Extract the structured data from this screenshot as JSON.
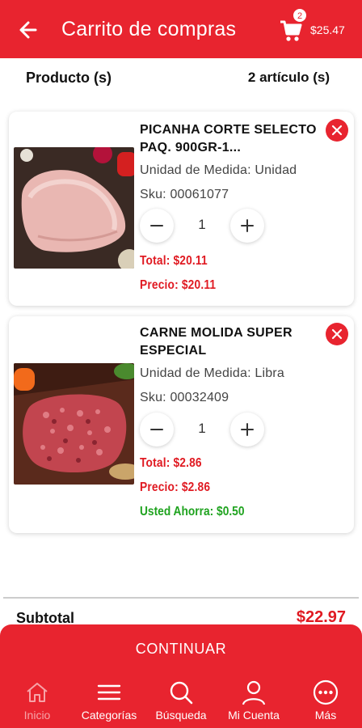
{
  "header": {
    "title": "Carrito de compras",
    "cart_count": "2",
    "cart_total": "$25.47"
  },
  "list_header": {
    "product_label": "Producto (s)",
    "item_count": "2 artículo (s)"
  },
  "items": [
    {
      "name": "PICANHA CORTE SELECTO PAQ. 900GR-1...",
      "unit": "Unidad de Medida: Unidad",
      "sku": "Sku: 00061077",
      "quantity": "1",
      "total": "Total: $20.11",
      "price": "Precio: $20.11",
      "image_icon": "picanha-beef-image"
    },
    {
      "name": "CARNE MOLIDA SUPER ESPECIAL",
      "unit": "Unidad de Medida: Libra",
      "sku": "Sku: 00032409",
      "quantity": "1",
      "total": "Total: $2.86",
      "price": "Precio: $2.86",
      "savings": "Usted Ahorra: $0.50",
      "image_icon": "ground-beef-image"
    }
  ],
  "summary": {
    "subtotal_label": "Subtotal",
    "subtotal_value": "$22.97",
    "continue_label": "CONTINUAR"
  },
  "nav": {
    "items": [
      {
        "label": "Inicio",
        "icon": "home-icon",
        "active": true
      },
      {
        "label": "Categorías",
        "icon": "menu-icon"
      },
      {
        "label": "Búsqueda",
        "icon": "search-icon"
      },
      {
        "label": "Mi Cuenta",
        "icon": "user-icon"
      },
      {
        "label": "Más",
        "icon": "more-icon"
      }
    ]
  },
  "colors": {
    "brand_red": "#e8242f",
    "price_red": "#e01a22",
    "savings_green": "#1fa31f"
  }
}
